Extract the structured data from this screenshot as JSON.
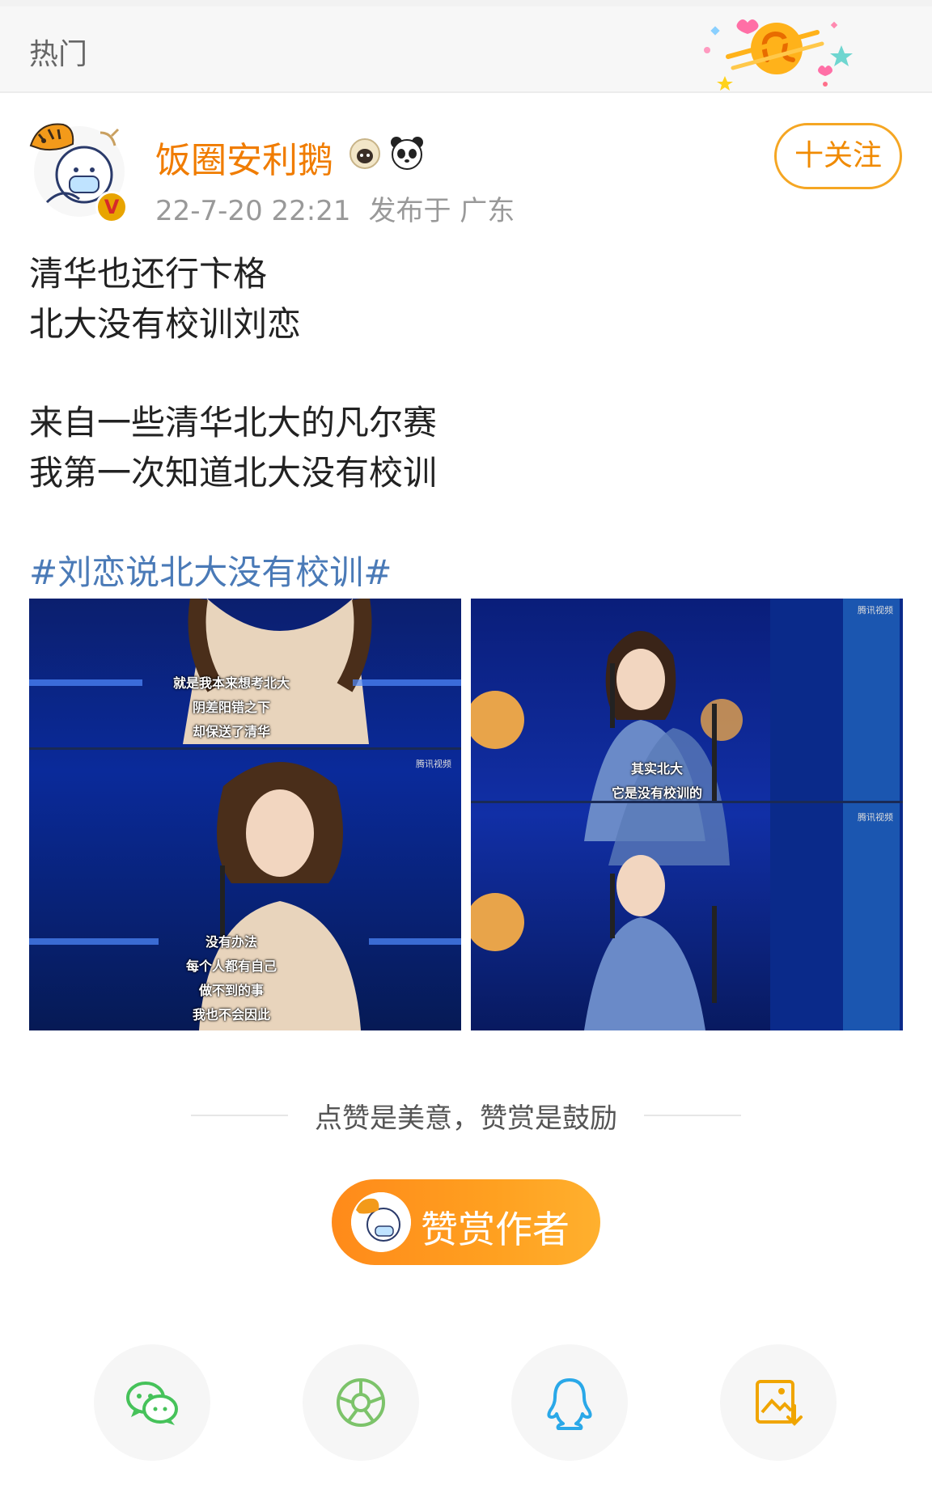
{
  "header": {
    "title": "热门",
    "decor_icon": "leo-zodiac-icon"
  },
  "post": {
    "author": {
      "name": "饭圈安利鹅",
      "verified_icon": "verified-v-icon",
      "badges": [
        "sheep-badge-icon",
        "panda-badge-icon"
      ]
    },
    "time": "22-7-20 22:21",
    "location": "发布于 广东",
    "follow_label": "十关注",
    "lines": [
      "清华也还行卞格",
      "北大没有校训刘恋",
      "来自一些清华北大的凡尔赛",
      "我第一次知道北大没有校训"
    ],
    "hashtag": "#刘恋说北大没有校训#",
    "images": [
      {
        "captions_top": [
          "就是我本来想考北大",
          "阴差阳错之下",
          "却保送了清华"
        ],
        "captions_bottom": [
          "没有办法",
          "每个人都有自己",
          "做不到的事",
          "我也不会因此"
        ],
        "watermark": "腾讯视频"
      },
      {
        "captions_top": [
          "其实北大",
          "它是没有校训的"
        ],
        "watermark": "腾讯视频"
      }
    ]
  },
  "reward": {
    "tagline": "点赞是美意，赞赏是鼓励",
    "button_label": "赞赏作者"
  },
  "share": [
    "wechat-icon",
    "moments-icon",
    "qq-icon",
    "save-image-icon"
  ],
  "colors": {
    "accent": "#f07c00",
    "link": "#4a7ab7",
    "reward": "#ff9a1f"
  }
}
